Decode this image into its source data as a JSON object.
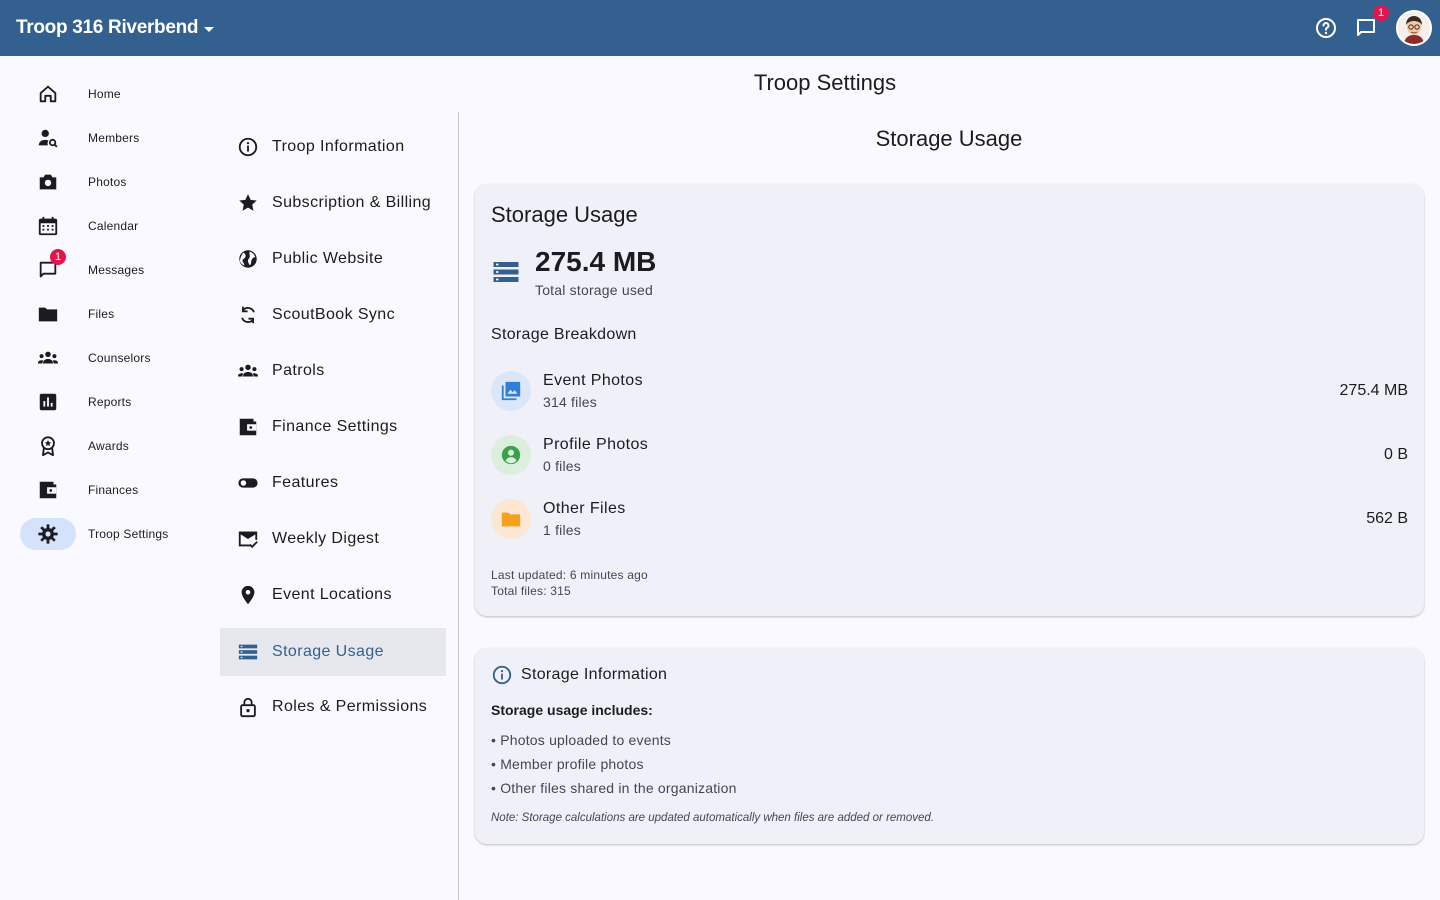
{
  "topbar": {
    "org_name": "Troop 316 Riverbend",
    "messages_badge": "1",
    "colors": {
      "bar": "#34608f"
    }
  },
  "rail": {
    "items": [
      {
        "label": "Home",
        "icon": "home-icon"
      },
      {
        "label": "Members",
        "icon": "person-search-icon"
      },
      {
        "label": "Photos",
        "icon": "camera-icon"
      },
      {
        "label": "Calendar",
        "icon": "calendar-icon"
      },
      {
        "label": "Messages",
        "icon": "chat-icon",
        "badge": "1"
      },
      {
        "label": "Files",
        "icon": "folder-icon"
      },
      {
        "label": "Counselors",
        "icon": "groups-icon"
      },
      {
        "label": "Reports",
        "icon": "bar-chart-icon"
      },
      {
        "label": "Awards",
        "icon": "award-icon"
      },
      {
        "label": "Finances",
        "icon": "wallet-icon"
      },
      {
        "label": "Troop Settings",
        "icon": "gear-icon",
        "active": true
      }
    ]
  },
  "page_title": "Troop Settings",
  "submenu": {
    "items": [
      {
        "label": "Troop Information",
        "icon": "info-icon"
      },
      {
        "label": "Subscription & Billing",
        "icon": "star-icon"
      },
      {
        "label": "Public Website",
        "icon": "globe-icon"
      },
      {
        "label": "ScoutBook Sync",
        "icon": "sync-icon"
      },
      {
        "label": "Patrols",
        "icon": "groups-icon"
      },
      {
        "label": "Finance Settings",
        "icon": "wallet-icon"
      },
      {
        "label": "Features",
        "icon": "toggle-icon"
      },
      {
        "label": "Weekly Digest",
        "icon": "mail-check-icon"
      },
      {
        "label": "Event Locations",
        "icon": "location-pin-icon"
      },
      {
        "label": "Storage Usage",
        "icon": "storage-icon",
        "active": true
      },
      {
        "label": "Roles & Permissions",
        "icon": "lock-icon"
      }
    ]
  },
  "section_title": "Storage Usage",
  "storage_card": {
    "title": "Storage Usage",
    "total_value": "275.4 MB",
    "total_caption": "Total storage used",
    "breakdown_title": "Storage Breakdown",
    "rows": [
      {
        "name": "Event Photos",
        "count": "314 files",
        "size": "275.4 MB",
        "icon": "photo-library-icon",
        "color": "#2f7fd6",
        "bg": "#dbe7f8"
      },
      {
        "name": "Profile Photos",
        "count": "0 files",
        "size": "0 B",
        "icon": "account-circle-icon",
        "color": "#3aa14a",
        "bg": "#dcefdc"
      },
      {
        "name": "Other Files",
        "count": "1 files",
        "size": "562 B",
        "icon": "folder-icon",
        "color": "#f5a11e",
        "bg": "#fbe7d2"
      }
    ],
    "last_updated": "Last updated: 6 minutes ago",
    "total_files": "Total files: 315"
  },
  "info_card": {
    "title": "Storage Information",
    "subtitle": "Storage usage includes:",
    "bullets": [
      "• Photos uploaded to events",
      "• Member profile photos",
      "• Other files shared in the organization"
    ],
    "note": "Note: Storage calculations are updated automatically when files are added or removed."
  }
}
